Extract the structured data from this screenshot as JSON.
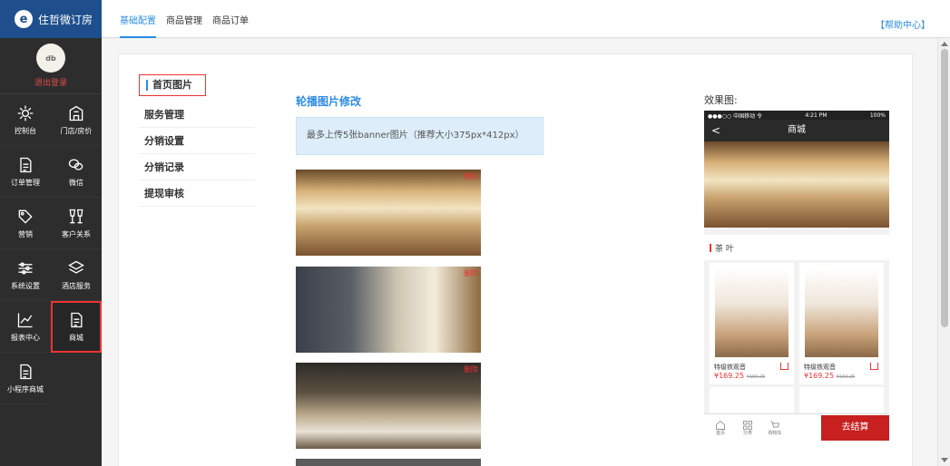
{
  "brand": {
    "name": "住哲微订房",
    "logo_glyph": "e"
  },
  "user": {
    "avatar_text": "db",
    "logout": "退出登录"
  },
  "sidebar": {
    "items": [
      {
        "label": "控制台",
        "icon": "gear-icon"
      },
      {
        "label": "门店/房价",
        "icon": "building-icon"
      },
      {
        "label": "订单管理",
        "icon": "document-icon"
      },
      {
        "label": "微信",
        "icon": "wechat-icon"
      },
      {
        "label": "营销",
        "icon": "tag-icon"
      },
      {
        "label": "客户关系",
        "icon": "cups-icon"
      },
      {
        "label": "系统设置",
        "icon": "sliders-icon"
      },
      {
        "label": "酒店服务",
        "icon": "layers-icon"
      },
      {
        "label": "报表中心",
        "icon": "chart-icon"
      },
      {
        "label": "商城",
        "icon": "document-icon"
      },
      {
        "label": "小程序商城",
        "icon": "document-icon"
      }
    ]
  },
  "topbar": {
    "tabs": [
      "基础配置",
      "商品管理",
      "商品订单"
    ],
    "help": "【帮助中心】"
  },
  "submenu": [
    "首页图片",
    "服务管理",
    "分销设置",
    "分销记录",
    "提现审核"
  ],
  "content": {
    "title": "轮播图片修改",
    "notice": "最多上传5张banner图片（推荐大小375px*412px）",
    "delete_label": "删除"
  },
  "preview": {
    "label": "效果图:",
    "status_left": "●●●○○ 中国移动 令",
    "status_time": "4:21 PM",
    "status_right": "100%",
    "back": "<",
    "header": "商城",
    "category": "茶 叶",
    "products": [
      {
        "name": "特级铁观音",
        "price": "¥169.25",
        "old_price": "¥169.25"
      },
      {
        "name": "特级铁观音",
        "price": "¥169.25",
        "old_price": "¥169.25"
      }
    ],
    "bottom_tabs": [
      "首页",
      "分类",
      "购物车"
    ],
    "checkout": "去结算"
  },
  "colors": {
    "accent": "#2b8ce6",
    "brand": "#1e4f8c",
    "danger": "#e33333",
    "checkout": "#c81f1f"
  }
}
